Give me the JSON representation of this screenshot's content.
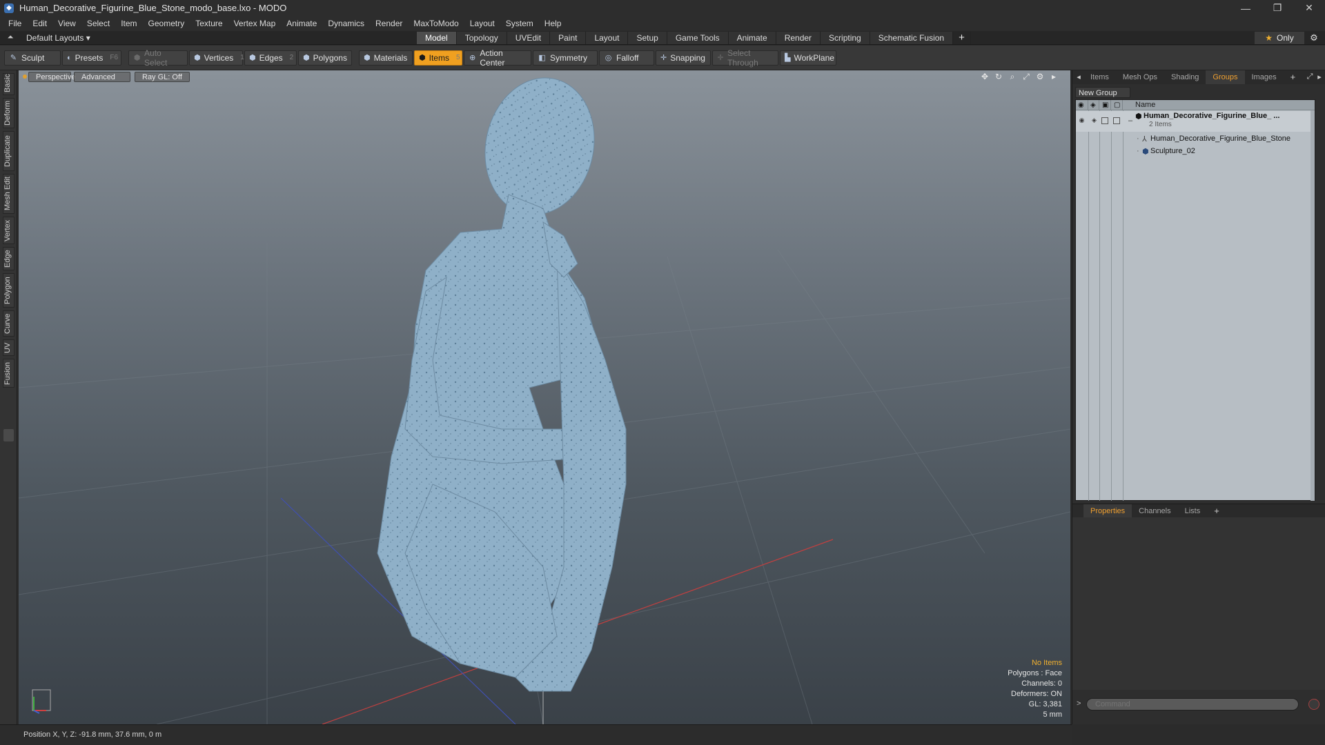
{
  "window": {
    "title": "Human_Decorative_Figurine_Blue_Stone_modo_base.lxo - MODO",
    "minimize": "—",
    "maximize": "❐",
    "close": "✕"
  },
  "menubar": [
    "File",
    "Edit",
    "View",
    "Select",
    "Item",
    "Geometry",
    "Texture",
    "Vertex Map",
    "Animate",
    "Dynamics",
    "Render",
    "MaxToModo",
    "Layout",
    "System",
    "Help"
  ],
  "layoutbar": {
    "layout_dropdown": "Default Layouts ▾",
    "tabs": [
      "Model",
      "Topology",
      "UVEdit",
      "Paint",
      "Layout",
      "Setup",
      "Game Tools",
      "Animate",
      "Render",
      "Scripting",
      "Schematic Fusion"
    ],
    "active_tab": "Model",
    "add": "+",
    "only_label": "Only"
  },
  "toolbar": {
    "sculpt": "Sculpt",
    "presets": "Presets",
    "presets_key": "F6",
    "auto_select": "Auto Select",
    "vertices": "Vertices",
    "vertices_key": "1",
    "edges": "Edges",
    "edges_key": "2",
    "polygons": "Polygons",
    "materials": "Materials",
    "items": "Items",
    "items_key": "5",
    "action_center": "Action Center",
    "symmetry": "Symmetry",
    "falloff": "Falloff",
    "snapping": "Snapping",
    "select_through": "Select Through",
    "workplane": "WorkPlane"
  },
  "left_tabs": [
    "Basic",
    "Deform",
    "Duplicate",
    "Mesh Edit",
    "Vertex",
    "Edge",
    "Polygon",
    "Curve",
    "UV",
    "Fusion"
  ],
  "viewport": {
    "view_mode": "Perspective",
    "shading": "Advanced",
    "raygl": "Ray GL: Off",
    "info": {
      "no_items": "No Items",
      "polygons": "Polygons : Face",
      "channels": "Channels: 0",
      "deformers": "Deformers: ON",
      "gl": "GL: 3,381",
      "scale": "5 mm"
    },
    "figure_color": "#8fb0c8"
  },
  "right_panel": {
    "tabs": [
      "Items",
      "Mesh Ops",
      "Shading",
      "Groups",
      "Images"
    ],
    "active_tab": "Groups",
    "add": "+",
    "new_group": "New Group",
    "name_header": "Name",
    "group_name": "Human_Decorative_Figurine_Blue_ ...",
    "group_count": "2 Items",
    "children": [
      "Human_Decorative_Figurine_Blue_Stone",
      "Sculpture_02"
    ],
    "props_tabs": [
      "Properties",
      "Channels",
      "Lists"
    ],
    "props_active": "Properties",
    "command_placeholder": "Command"
  },
  "statusbar": {
    "position": "Position X, Y, Z:  -91.8 mm, 37.6 mm, 0 m"
  },
  "colors": {
    "accent": "#f0a020",
    "viewport_top": "#8a929a",
    "viewport_bottom": "#3a4148"
  }
}
